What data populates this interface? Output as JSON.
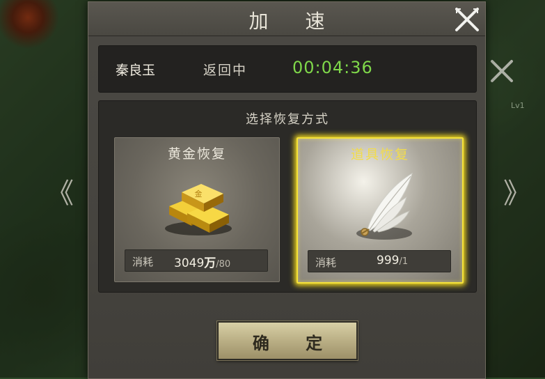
{
  "dialog": {
    "title": "加 速",
    "close_icon": "close-x-icon"
  },
  "info": {
    "hero_name": "秦良玉",
    "status": "返回中",
    "timer": "00:04:36",
    "timer_color": "#7fd84a"
  },
  "method": {
    "title": "选择恢复方式",
    "options": [
      {
        "title": "黄金恢复",
        "icon": "gold-bars-icon",
        "cost_label": "消耗",
        "cost_value": "3049",
        "cost_unit": "万",
        "cost_limit": "/80",
        "selected": false
      },
      {
        "title": "道具恢复",
        "icon": "feather-icon",
        "cost_label": "消耗",
        "cost_value": "999",
        "cost_unit": "",
        "cost_limit": "/1",
        "selected": true
      }
    ],
    "selected_color": "#f5e23a"
  },
  "confirm_label": "确 定",
  "background": {
    "left_arrow": "《",
    "right_arrow": "》",
    "level_badge": "Lv1"
  }
}
